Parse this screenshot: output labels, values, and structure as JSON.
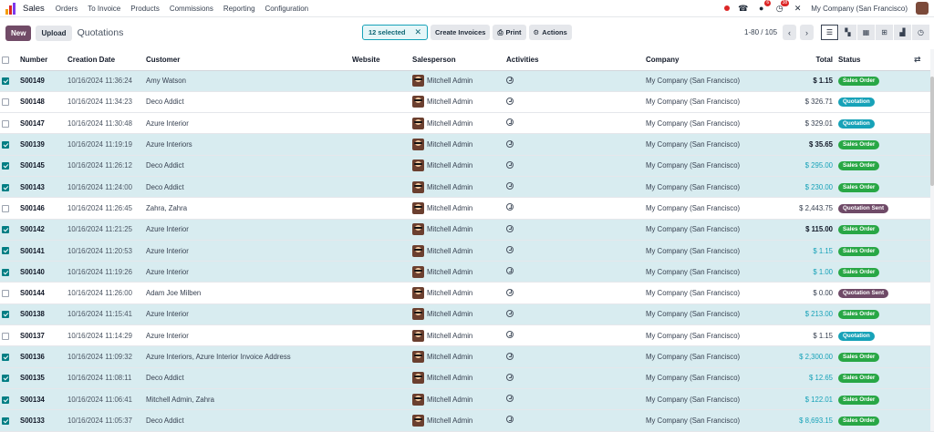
{
  "navbar": {
    "app_name": "Sales",
    "menu": [
      "Orders",
      "To Invoice",
      "Products",
      "Commissions",
      "Reporting",
      "Configuration"
    ],
    "messages_count": "6",
    "activities_count": "38",
    "company": "My Company (San Francisco)"
  },
  "control": {
    "new_label": "New",
    "upload_label": "Upload",
    "title": "Quotations",
    "selected_label": "12 selected",
    "create_invoices_label": "Create Invoices",
    "print_label": "Print",
    "actions_label": "Actions",
    "pager": "1-80 / 105"
  },
  "columns": {
    "number": "Number",
    "creation_date": "Creation Date",
    "customer": "Customer",
    "website": "Website",
    "salesperson": "Salesperson",
    "activities": "Activities",
    "company": "Company",
    "total": "Total",
    "status": "Status"
  },
  "rows": [
    {
      "selected": true,
      "number": "S00149",
      "date": "10/16/2024 11:36:24",
      "customer": "Amy Watson",
      "salesperson": "Mitchell Admin",
      "company": "My Company (San Francisco)",
      "total": "$ 1.15",
      "total_style": "bold",
      "status": "Sales Order"
    },
    {
      "selected": false,
      "number": "S00148",
      "date": "10/16/2024 11:34:23",
      "customer": "Deco Addict",
      "salesperson": "Mitchell Admin",
      "company": "My Company (San Francisco)",
      "total": "$ 326.71",
      "total_style": "plain",
      "status": "Quotation"
    },
    {
      "selected": false,
      "number": "S00147",
      "date": "10/16/2024 11:30:48",
      "customer": "Azure Interior",
      "salesperson": "Mitchell Admin",
      "company": "My Company (San Francisco)",
      "total": "$ 329.01",
      "total_style": "plain",
      "status": "Quotation"
    },
    {
      "selected": true,
      "number": "S00139",
      "date": "10/16/2024 11:19:19",
      "customer": "Azure Interiors",
      "salesperson": "Mitchell Admin",
      "company": "My Company (San Francisco)",
      "total": "$ 35.65",
      "total_style": "bold",
      "status": "Sales Order"
    },
    {
      "selected": true,
      "number": "S00145",
      "date": "10/16/2024 11:26:12",
      "customer": "Deco Addict",
      "salesperson": "Mitchell Admin",
      "company": "My Company (San Francisco)",
      "total": "$ 295.00",
      "total_style": "teal",
      "status": "Sales Order"
    },
    {
      "selected": true,
      "number": "S00143",
      "date": "10/16/2024 11:24:00",
      "customer": "Deco Addict",
      "salesperson": "Mitchell Admin",
      "company": "My Company (San Francisco)",
      "total": "$ 230.00",
      "total_style": "teal",
      "status": "Sales Order"
    },
    {
      "selected": false,
      "number": "S00146",
      "date": "10/16/2024 11:26:45",
      "customer": "Zahra, Zahra",
      "salesperson": "Mitchell Admin",
      "company": "My Company (San Francisco)",
      "total": "$ 2,443.75",
      "total_style": "plain",
      "status": "Quotation Sent"
    },
    {
      "selected": true,
      "number": "S00142",
      "date": "10/16/2024 11:21:25",
      "customer": "Azure Interior",
      "salesperson": "Mitchell Admin",
      "company": "My Company (San Francisco)",
      "total": "$ 115.00",
      "total_style": "bold",
      "status": "Sales Order"
    },
    {
      "selected": true,
      "number": "S00141",
      "date": "10/16/2024 11:20:53",
      "customer": "Azure Interior",
      "salesperson": "Mitchell Admin",
      "company": "My Company (San Francisco)",
      "total": "$ 1.15",
      "total_style": "teal",
      "status": "Sales Order"
    },
    {
      "selected": true,
      "number": "S00140",
      "date": "10/16/2024 11:19:26",
      "customer": "Azure Interior",
      "salesperson": "Mitchell Admin",
      "company": "My Company (San Francisco)",
      "total": "$ 1.00",
      "total_style": "teal",
      "status": "Sales Order"
    },
    {
      "selected": false,
      "number": "S00144",
      "date": "10/16/2024 11:26:00",
      "customer": "Adam Joe Milben",
      "salesperson": "Mitchell Admin",
      "company": "My Company (San Francisco)",
      "total": "$ 0.00",
      "total_style": "plain",
      "status": "Quotation Sent"
    },
    {
      "selected": true,
      "number": "S00138",
      "date": "10/16/2024 11:15:41",
      "customer": "Azure Interior",
      "salesperson": "Mitchell Admin",
      "company": "My Company (San Francisco)",
      "total": "$ 213.00",
      "total_style": "teal",
      "status": "Sales Order"
    },
    {
      "selected": false,
      "number": "S00137",
      "date": "10/16/2024 11:14:29",
      "customer": "Azure Interior",
      "salesperson": "Mitchell Admin",
      "company": "My Company (San Francisco)",
      "total": "$ 1.15",
      "total_style": "plain",
      "status": "Quotation"
    },
    {
      "selected": true,
      "number": "S00136",
      "date": "10/16/2024 11:09:32",
      "customer": "Azure Interiors, Azure Interior Invoice Address",
      "salesperson": "Mitchell Admin",
      "company": "My Company (San Francisco)",
      "total": "$ 2,300.00",
      "total_style": "teal",
      "status": "Sales Order"
    },
    {
      "selected": true,
      "number": "S00135",
      "date": "10/16/2024 11:08:11",
      "customer": "Deco Addict",
      "salesperson": "Mitchell Admin",
      "company": "My Company (San Francisco)",
      "total": "$ 12.65",
      "total_style": "teal",
      "status": "Sales Order"
    },
    {
      "selected": true,
      "number": "S00134",
      "date": "10/16/2024 11:06:41",
      "customer": "Mitchell Admin, Zahra",
      "salesperson": "Mitchell Admin",
      "company": "My Company (San Francisco)",
      "total": "$ 122.01",
      "total_style": "teal",
      "status": "Sales Order"
    },
    {
      "selected": true,
      "number": "S00133",
      "date": "10/16/2024 11:05:37",
      "customer": "Deco Addict",
      "salesperson": "Mitchell Admin",
      "company": "My Company (San Francisco)",
      "total": "$ 8,693.15",
      "total_style": "teal",
      "status": "Sales Order"
    }
  ],
  "colors": {
    "brand": "#714b67",
    "sales_order": "#28a745",
    "quotation": "#17a2b8",
    "quotation_sent": "#6f4a67",
    "selected_row": "#d8ecf0"
  }
}
